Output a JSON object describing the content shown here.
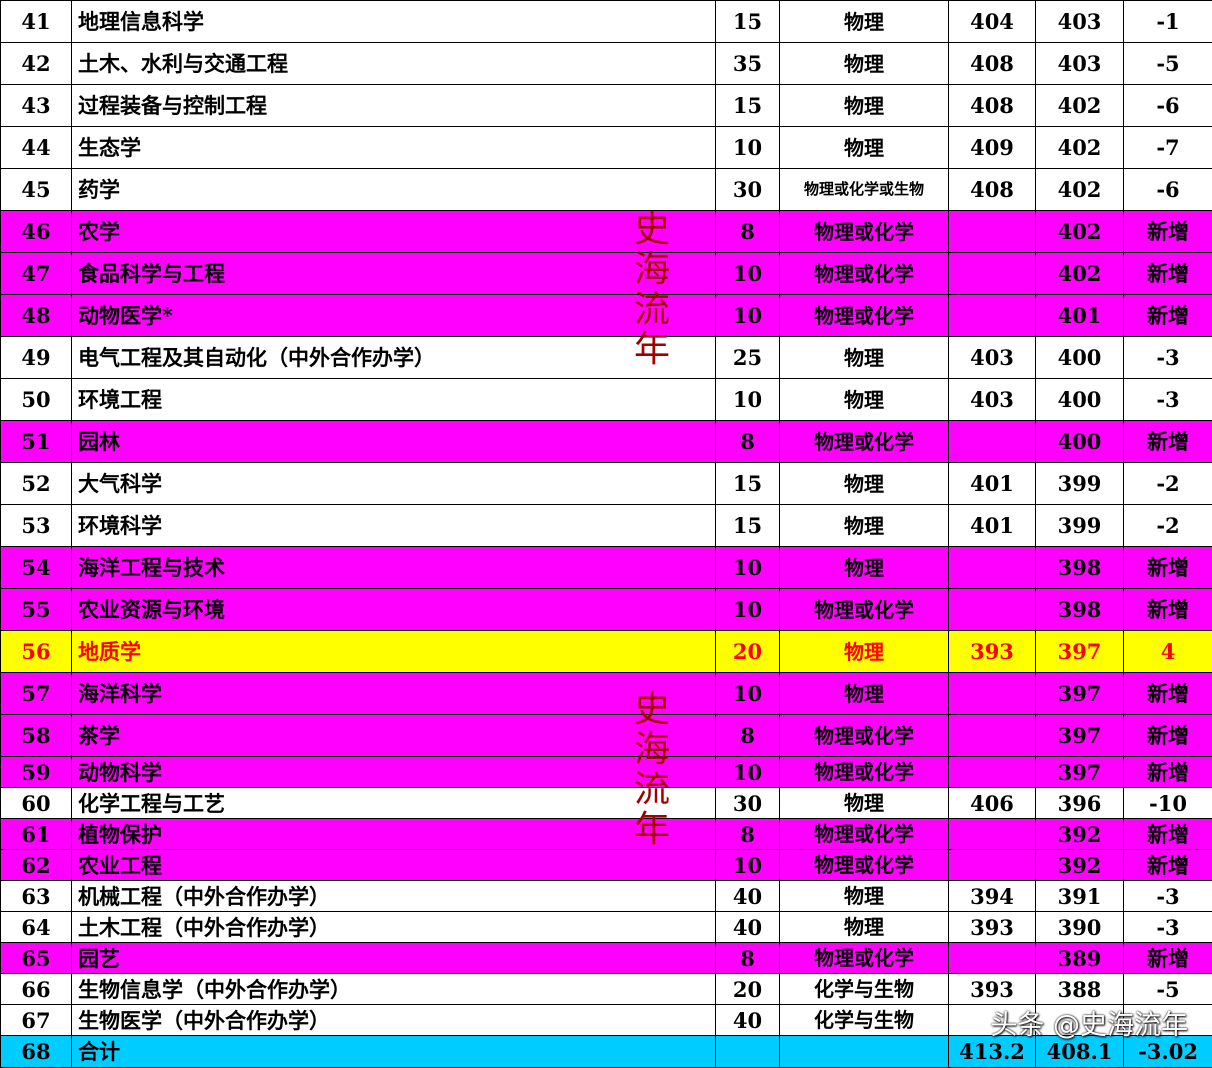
{
  "colors": {
    "white_row": "#ffffff",
    "new_row": "#ff00ff",
    "highlight_row": "#ffff00",
    "highlight_text": "#ff0000",
    "total_row": "#00ccff",
    "watermark": "#a30000"
  },
  "rows": [
    {
      "no": "41",
      "major": "地理信息科学",
      "plan": "15",
      "subject": "物理",
      "prev": "404",
      "curr": "403",
      "diff": "-1",
      "style": "white"
    },
    {
      "no": "42",
      "major": "土木、水利与交通工程",
      "plan": "35",
      "subject": "物理",
      "prev": "408",
      "curr": "403",
      "diff": "-5",
      "style": "white"
    },
    {
      "no": "43",
      "major": "过程装备与控制工程",
      "plan": "15",
      "subject": "物理",
      "prev": "408",
      "curr": "402",
      "diff": "-6",
      "style": "white"
    },
    {
      "no": "44",
      "major": "生态学",
      "plan": "10",
      "subject": "物理",
      "prev": "409",
      "curr": "402",
      "diff": "-7",
      "style": "white"
    },
    {
      "no": "45",
      "major": "药学",
      "plan": "30",
      "subject": "物理或化学或生物",
      "prev": "408",
      "curr": "402",
      "diff": "-6",
      "style": "white",
      "small": true
    },
    {
      "no": "46",
      "major": "农学",
      "plan": "8",
      "subject": "物理或化学",
      "prev": "",
      "curr": "402",
      "diff": "新增",
      "style": "magenta"
    },
    {
      "no": "47",
      "major": "食品科学与工程",
      "plan": "10",
      "subject": "物理或化学",
      "prev": "",
      "curr": "402",
      "diff": "新增",
      "style": "magenta"
    },
    {
      "no": "48",
      "major": "动物医学*",
      "plan": "10",
      "subject": "物理或化学",
      "prev": "",
      "curr": "401",
      "diff": "新增",
      "style": "magenta"
    },
    {
      "no": "49",
      "major": "电气工程及其自动化（中外合作办学）",
      "plan": "25",
      "subject": "物理",
      "prev": "403",
      "curr": "400",
      "diff": "-3",
      "style": "white"
    },
    {
      "no": "50",
      "major": "环境工程",
      "plan": "10",
      "subject": "物理",
      "prev": "403",
      "curr": "400",
      "diff": "-3",
      "style": "white"
    },
    {
      "no": "51",
      "major": "园林",
      "plan": "8",
      "subject": "物理或化学",
      "prev": "",
      "curr": "400",
      "diff": "新增",
      "style": "magenta"
    },
    {
      "no": "52",
      "major": "大气科学",
      "plan": "15",
      "subject": "物理",
      "prev": "401",
      "curr": "399",
      "diff": "-2",
      "style": "white"
    },
    {
      "no": "53",
      "major": "环境科学",
      "plan": "15",
      "subject": "物理",
      "prev": "401",
      "curr": "399",
      "diff": "-2",
      "style": "white"
    },
    {
      "no": "54",
      "major": "海洋工程与技术",
      "plan": "10",
      "subject": "物理",
      "prev": "",
      "curr": "398",
      "diff": "新增",
      "style": "magenta"
    },
    {
      "no": "55",
      "major": "农业资源与环境",
      "plan": "10",
      "subject": "物理或化学",
      "prev": "",
      "curr": "398",
      "diff": "新增",
      "style": "magenta"
    },
    {
      "no": "56",
      "major": "地质学",
      "plan": "20",
      "subject": "物理",
      "prev": "393",
      "curr": "397",
      "diff": "4",
      "style": "yellow"
    },
    {
      "no": "57",
      "major": "海洋科学",
      "plan": "10",
      "subject": "物理",
      "prev": "",
      "curr": "397",
      "diff": "新增",
      "style": "magenta"
    },
    {
      "no": "58",
      "major": "茶学",
      "plan": "8",
      "subject": "物理或化学",
      "prev": "",
      "curr": "397",
      "diff": "新增",
      "style": "magenta"
    },
    {
      "no": "59",
      "major": "动物科学",
      "plan": "10",
      "subject": "物理或化学",
      "prev": "",
      "curr": "397",
      "diff": "新增",
      "style": "magenta"
    },
    {
      "no": "60",
      "major": "化学工程与工艺",
      "plan": "30",
      "subject": "物理",
      "prev": "406",
      "curr": "396",
      "diff": "-10",
      "style": "white"
    },
    {
      "no": "61",
      "major": "植物保护",
      "plan": "8",
      "subject": "物理或化学",
      "prev": "",
      "curr": "392",
      "diff": "新增",
      "style": "magenta"
    },
    {
      "no": "62",
      "major": "农业工程",
      "plan": "10",
      "subject": "物理或化学",
      "prev": "",
      "curr": "392",
      "diff": "新增",
      "style": "magenta"
    },
    {
      "no": "63",
      "major": "机械工程（中外合作办学）",
      "plan": "40",
      "subject": "物理",
      "prev": "394",
      "curr": "391",
      "diff": "-3",
      "style": "white"
    },
    {
      "no": "64",
      "major": "土木工程（中外合作办学）",
      "plan": "40",
      "subject": "物理",
      "prev": "393",
      "curr": "390",
      "diff": "-3",
      "style": "white"
    },
    {
      "no": "65",
      "major": "园艺",
      "plan": "8",
      "subject": "物理或化学",
      "prev": "",
      "curr": "389",
      "diff": "新增",
      "style": "magenta"
    },
    {
      "no": "66",
      "major": "生物信息学（中外合作办学）",
      "plan": "20",
      "subject": "化学与生物",
      "prev": "393",
      "curr": "388",
      "diff": "-5",
      "style": "white"
    },
    {
      "no": "67",
      "major": "生物医学（中外合作办学）",
      "plan": "40",
      "subject": "化学与生物",
      "prev": "",
      "curr": "",
      "diff": "",
      "style": "white"
    },
    {
      "no": "68",
      "major": "合计",
      "plan": "",
      "subject": "",
      "prev": "413.2",
      "curr": "408.1",
      "diff": "-3.02",
      "style": "cyan"
    }
  ],
  "watermarks": [
    {
      "text": "史海流年"
    },
    {
      "text": "史海流年"
    }
  ],
  "credit": "头条 @史海流年"
}
